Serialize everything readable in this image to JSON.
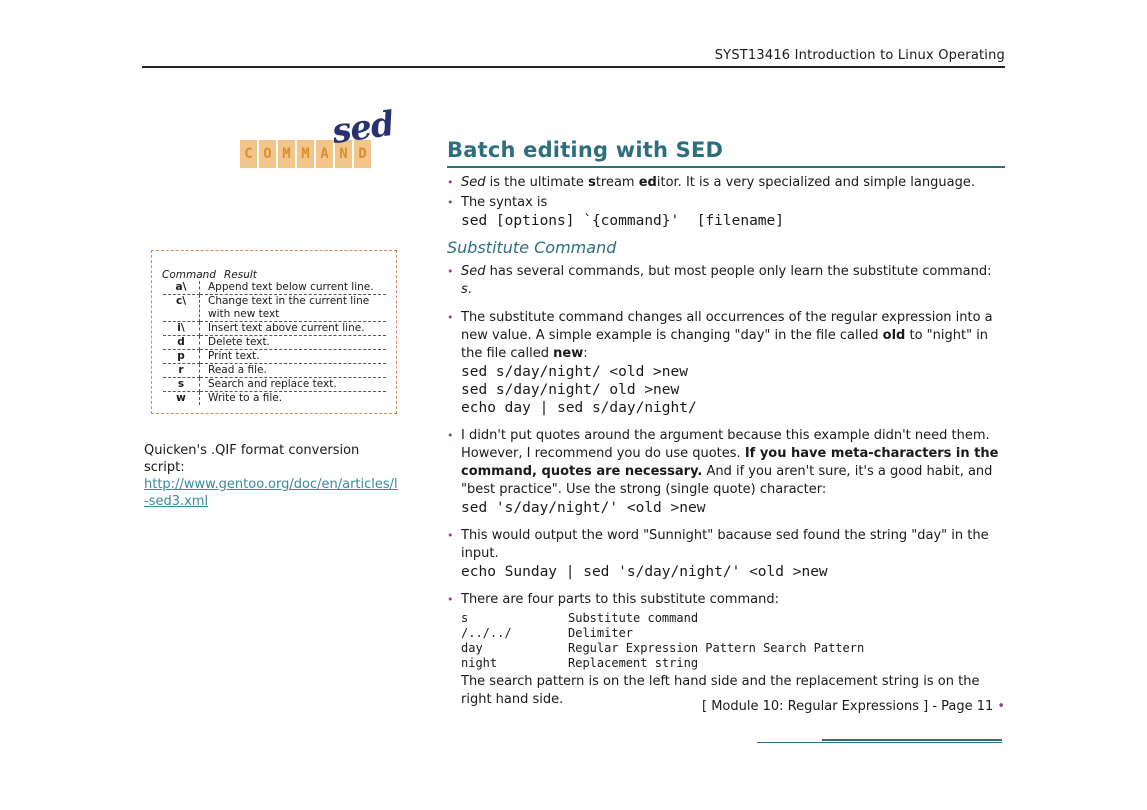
{
  "header": {
    "title": "SYST13416 Introduction to Linux Operating"
  },
  "logo": {
    "tiles": [
      "C",
      "O",
      "M",
      "M",
      "A",
      "N",
      "D"
    ],
    "script": "sed"
  },
  "command_box": {
    "head_command": "Command",
    "head_result": "Result",
    "rows": [
      {
        "cmd": "a\\",
        "result": "Append text below current line."
      },
      {
        "cmd": "c\\",
        "result": "Change text in the current line with new text"
      },
      {
        "cmd": "i\\",
        "result": "Insert text above current line."
      },
      {
        "cmd": "d",
        "result": "Delete text."
      },
      {
        "cmd": "p",
        "result": "Print text."
      },
      {
        "cmd": "r",
        "result": "Read a file."
      },
      {
        "cmd": "s",
        "result": "Search and replace text."
      },
      {
        "cmd": "w",
        "result": "Write to a file."
      }
    ]
  },
  "quicken": {
    "text": "Quicken's .QIF format conversion script:",
    "link": "http://www.gentoo.org/doc/en/articles/l-sed3.xml"
  },
  "main": {
    "title": "Batch editing with SED",
    "b1": {
      "p1": "Sed",
      "p2": " is the ultimate ",
      "p3": "s",
      "p4": "tream ",
      "p5": "ed",
      "p6": "itor. It is a very specialized and simple language."
    },
    "b2": {
      "text": "The syntax is",
      "code": "sed [options] `{command}'  [filename]"
    },
    "sub_title": "Substitute Command",
    "b3": {
      "p1": "Sed",
      "p2": " has several commands, but most people only learn the substitute command: ",
      "p3": "s",
      "p4": "."
    },
    "b4": {
      "p1": "The substitute command changes all occurrences of the regular expression into a new value. A simple example is changing \"day\" in the file called ",
      "p2": "old",
      "p3": " to \"night\" in the file called ",
      "p4": "new",
      "p5": ":",
      "code1": "sed s/day/night/ <old >new",
      "code2": "sed s/day/night/ old >new",
      "code3": "echo day | sed s/day/night/"
    },
    "b5": {
      "p1": "I didn't put quotes around the argument because this example didn't need them. However, I recommend you do use quotes. ",
      "p2": "If you have meta-characters in the command, quotes are necessary.",
      "p3": " And if you aren't sure, it's a good habit, and \"best practice\". Use the strong (single quote) character:",
      "code": "sed 's/day/night/' <old >new"
    },
    "b6": {
      "text": "This would output the word \"Sunnight\" bacause sed found the string \"day\" in the input.",
      "code": "echo Sunday | sed 's/day/night/' <old >new"
    },
    "b7": {
      "text": "There are four parts to this substitute command:",
      "parts": [
        {
          "k": "s",
          "v": "Substitute command"
        },
        {
          "k": "/../../",
          "v": "Delimiter"
        },
        {
          "k": "day",
          "v": "Regular Expression Pattern Search Pattern"
        },
        {
          "k": "night",
          "v": "Replacement string"
        }
      ],
      "after": "The search pattern is on the left hand side and the replacement string is on the right hand side."
    }
  },
  "footer": {
    "text": "[ Module 10:  Regular Expressions ] - Page 11",
    "dot": "•"
  }
}
